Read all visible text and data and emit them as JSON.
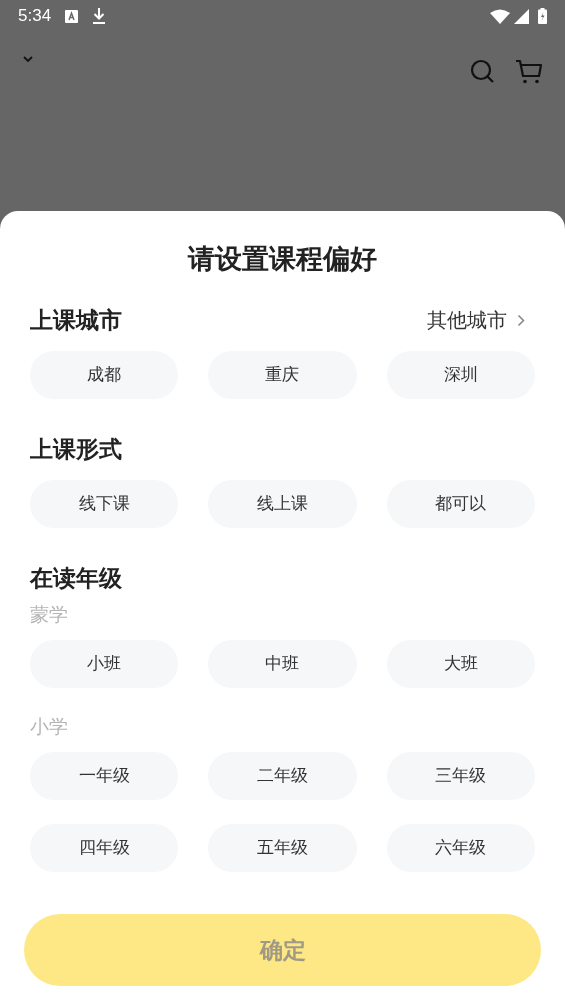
{
  "status_bar": {
    "time": "5:34"
  },
  "sheet": {
    "title": "请设置课程偏好",
    "sections": [
      {
        "title": "上课城市",
        "link": "其他城市",
        "groups": [
          {
            "options": [
              {
                "label": "成都",
                "selected": false
              },
              {
                "label": "重庆",
                "selected": false
              },
              {
                "label": "深圳",
                "selected": false
              }
            ]
          }
        ]
      },
      {
        "title": "上课形式",
        "groups": [
          {
            "options": [
              {
                "label": "线下课",
                "selected": false
              },
              {
                "label": "线上课",
                "selected": false
              },
              {
                "label": "都可以",
                "selected": false
              }
            ]
          }
        ]
      },
      {
        "title": "在读年级",
        "groups": [
          {
            "label": "蒙学",
            "options": [
              {
                "label": "小班",
                "selected": false
              },
              {
                "label": "中班",
                "selected": false
              },
              {
                "label": "大班",
                "selected": false
              }
            ]
          },
          {
            "label": "小学",
            "options": [
              {
                "label": "一年级",
                "selected": false
              },
              {
                "label": "二年级",
                "selected": false
              },
              {
                "label": "三年级",
                "selected": false
              },
              {
                "label": "四年级",
                "selected": false
              },
              {
                "label": "五年级",
                "selected": false
              },
              {
                "label": "六年级",
                "selected": false
              }
            ]
          }
        ]
      }
    ],
    "confirm": {
      "label": "确定",
      "disabled": true
    }
  }
}
